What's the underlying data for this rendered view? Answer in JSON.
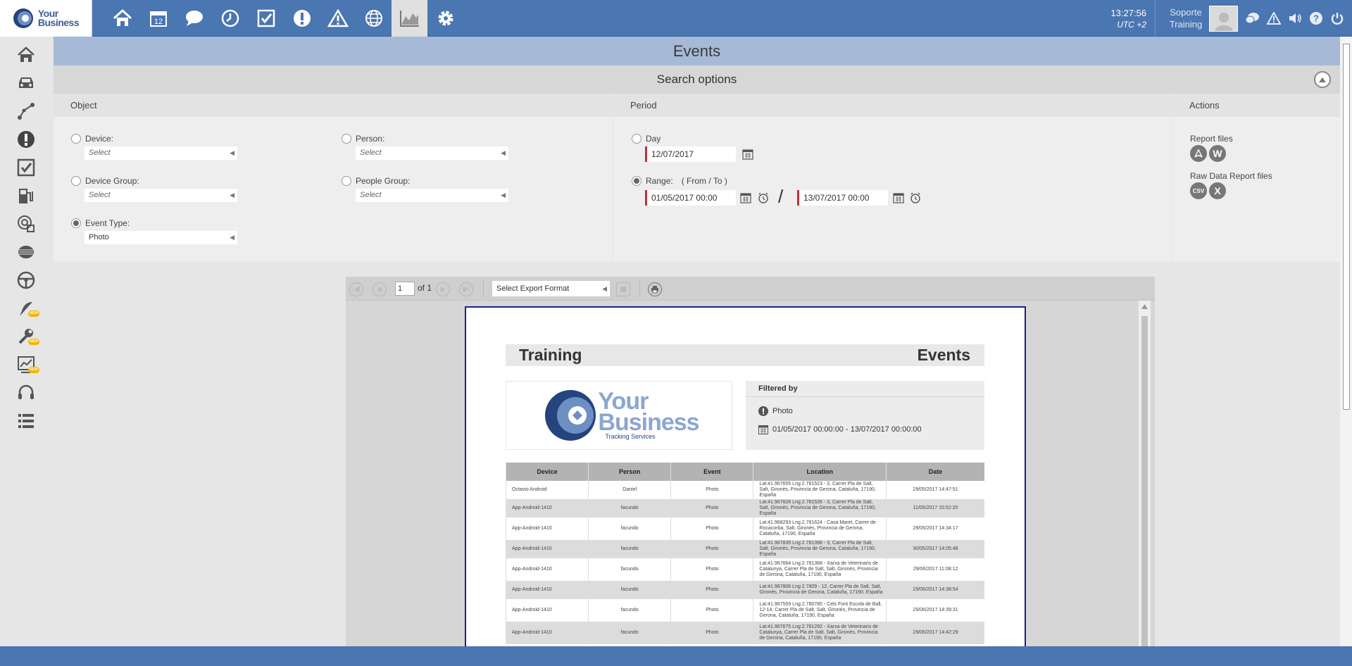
{
  "app": {
    "logo_line1": "Your",
    "logo_line2": "Business"
  },
  "topbar": {
    "icons": [
      "home-icon",
      "calendar-icon",
      "chat-icon",
      "clock-icon",
      "checklist-icon",
      "alert-icon",
      "warning-icon",
      "globe-icon",
      "report-chart-icon",
      "settings-icon"
    ],
    "calendar_num": "12",
    "time": "13:27:56",
    "timezone": "UTC +2",
    "user_line1": "Soporte",
    "user_line2": "Training"
  },
  "page": {
    "title": "Events"
  },
  "search": {
    "title": "Search options"
  },
  "object": {
    "title": "Object",
    "device_label": "Device:",
    "device_placeholder": "Select",
    "person_label": "Person:",
    "person_placeholder": "Select",
    "device_group_label": "Device Group:",
    "device_group_placeholder": "Select",
    "people_group_label": "People Group:",
    "people_group_placeholder": "Select",
    "event_type_label": "Event Type:",
    "event_type_value": "Photo"
  },
  "period": {
    "title": "Period",
    "day_label": "Day",
    "day_value": "12/07/2017",
    "range_label": "Range:",
    "range_hint": "( From / To )",
    "from_value": "01/05/2017 00:00",
    "separator": "/",
    "to_value": "13/07/2017 00:00"
  },
  "actions": {
    "title": "Actions",
    "report_files": "Report files",
    "raw_files": "Raw Data Report files",
    "csv": "CSV",
    "x": "X",
    "w": "W"
  },
  "viewer": {
    "page_num": "1",
    "of_label": "of 1",
    "export_placeholder": "Select Export Format"
  },
  "report": {
    "left_title": "Training",
    "right_title": "Events",
    "logo_sub": "Tracking Services",
    "filtered_by": "Filtered by",
    "filter_event": "Photo",
    "filter_dates": "01/05/2017 00:00:00 - 13/07/2017 00:00:00",
    "columns": [
      "Device",
      "Person",
      "Event",
      "Location",
      "Date"
    ],
    "rows": [
      [
        "Octavio Android",
        "Daniel",
        "Photo",
        "Lat:41.967655 Lng:2.781523 - 3, Carrer Pla de Salt, Salt, Gironès, Provincia de Gerona, Cataluña, 17190, España",
        "29/05/2017 14:47:51"
      ],
      [
        "App-Android-1410",
        "facundo",
        "Photo",
        "Lat:41.967828 Lng:2.781526 - 3, Carrer Pla de Salt, Salt, Gironès, Provincia de Gerona, Cataluña, 17190, España",
        "11/05/2017 15:52:20"
      ],
      [
        "App-Android-1410",
        "facundo",
        "Photo",
        "Lat:41.968293 Lng:2.781624 - Casa Maret, Carrer de Rocacorba, Salt, Gironès, Provincia de Gerona, Cataluña, 17190, España",
        "29/05/2017 14:34:17"
      ],
      [
        "App-Android-1410",
        "facundo",
        "Photo",
        "Lat:41.967839 Lng:2.781398 - 3, Carrer Pla de Salt, Salt, Gironès, Provincia de Gerona, Cataluña, 17190, España",
        "30/05/2017 14:05:48"
      ],
      [
        "App-Android-1410",
        "facundo",
        "Photo",
        "Lat:41.967664 Lng:2.781368 - Xarxa de Veterinaris de Catalunya, Carrer Pla de Salt, Salt, Gironès, Provincia de Gerona, Cataluña, 17190, España",
        "29/06/2017 11:08:12"
      ],
      [
        "App-Android-1410",
        "facundo",
        "Photo",
        "Lat:41.967806 Lng:2.7809 - 12, Carrer Pla de Salt, Salt, Gironès, Provincia de Gerona, Cataluña, 17190, España",
        "29/06/2017 14:38:54"
      ],
      [
        "App-Android-1410",
        "facundo",
        "Photo",
        "Lat:41.967559 Lng:2.780785 - Cels Font Escola de Ball, 12-14, Carrer Pla de Salt, Salt, Gironès, Provincia de Gerona, Cataluña, 17190, España",
        "29/06/2017 14:39:31"
      ],
      [
        "App-Android-1410",
        "facundo",
        "Photo",
        "Lat:41.967675 Lng:2.781292 - Xarxa de Veterinaris de Catalunya, Carrer Pla de Salt, Salt, Gironès, Provincia de Gerona, Cataluña, 17190, España",
        "29/06/2017 14:42:29"
      ]
    ]
  },
  "sidebar": {
    "items": [
      "home-icon",
      "vehicle-icon",
      "route-icon",
      "alert-icon",
      "checklist-icon",
      "fuel-icon",
      "geofence-icon",
      "tire-icon",
      "steering-wheel-icon",
      "feather-icon",
      "wrench-icon",
      "chart-edit-icon",
      "headset-icon",
      "list-icon"
    ],
    "new_badge": "NEW"
  },
  "colors": {
    "brand": "#4a76b1",
    "title_bar": "#a6bad7",
    "required": "#c03030"
  }
}
